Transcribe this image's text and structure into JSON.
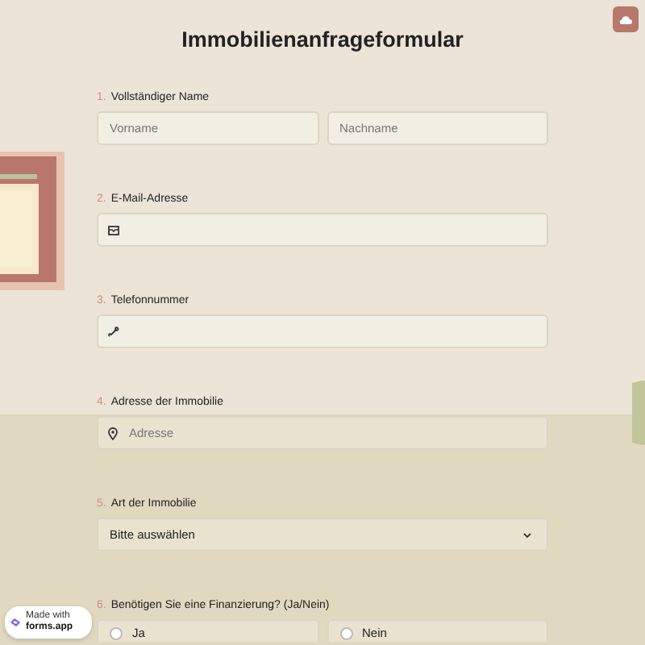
{
  "title": "Immobilienanfrageformular",
  "questions": [
    {
      "kind": "name",
      "number": "1.",
      "label": "Vollständiger Name",
      "fields": [
        {
          "placeholder": "Vorname"
        },
        {
          "placeholder": "Nachname"
        }
      ]
    },
    {
      "kind": "email",
      "number": "2.",
      "label": "E-Mail-Adresse"
    },
    {
      "kind": "phone",
      "number": "3.",
      "label": "Telefonnummer"
    },
    {
      "kind": "address",
      "number": "4.",
      "label": "Adresse der Immobilie",
      "placeholder": "Adresse"
    },
    {
      "kind": "select",
      "number": "5.",
      "label": "Art der Immobilie",
      "value": "Bitte auswählen"
    },
    {
      "kind": "radio",
      "number": "6.",
      "label": "Benötigen Sie eine Finanzierung? (Ja/Nein)",
      "options": [
        {
          "label": "Ja",
          "selected": false
        },
        {
          "label": "Nein",
          "selected": false
        }
      ]
    }
  ],
  "badge": {
    "prefix": "Made with",
    "brand": "forms.app"
  }
}
